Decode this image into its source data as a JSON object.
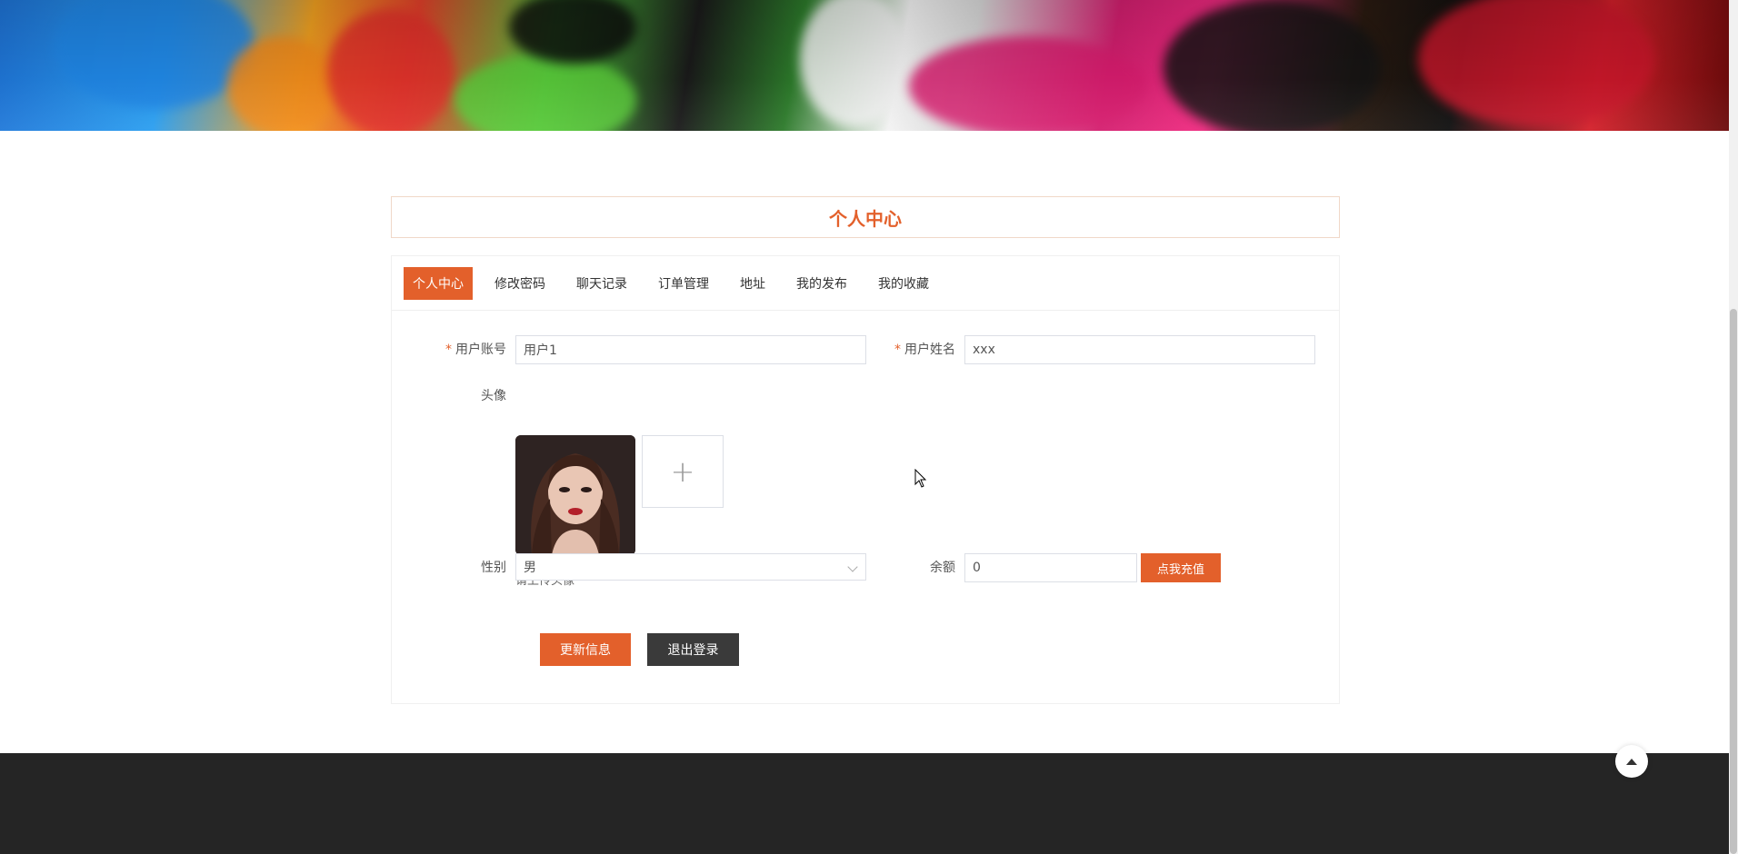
{
  "page": {
    "title": "个人中心"
  },
  "tabs": [
    {
      "label": "个人中心",
      "active": true
    },
    {
      "label": "修改密码",
      "active": false
    },
    {
      "label": "聊天记录",
      "active": false
    },
    {
      "label": "订单管理",
      "active": false
    },
    {
      "label": "地址",
      "active": false
    },
    {
      "label": "我的发布",
      "active": false
    },
    {
      "label": "我的收藏",
      "active": false
    }
  ],
  "form": {
    "account": {
      "label": "用户账号",
      "required_mark": "*",
      "value": "用户1"
    },
    "name": {
      "label": "用户姓名",
      "required_mark": "*",
      "value": "xxx"
    },
    "avatar": {
      "label": "头像",
      "hint": "请上传头像",
      "upload_icon": "+"
    },
    "gender": {
      "label": "性别",
      "value": "男"
    },
    "balance": {
      "label": "余额",
      "value": "0",
      "recharge_label": "点我充值"
    }
  },
  "actions": {
    "update_label": "更新信息",
    "logout_label": "退出登录"
  },
  "colors": {
    "accent": "#e3602b",
    "dark": "#3a3a3a",
    "footer": "#252525"
  },
  "icons": {
    "back_to_top": "arrow-up-icon",
    "add": "plus-icon",
    "select": "chevron-down-icon"
  }
}
